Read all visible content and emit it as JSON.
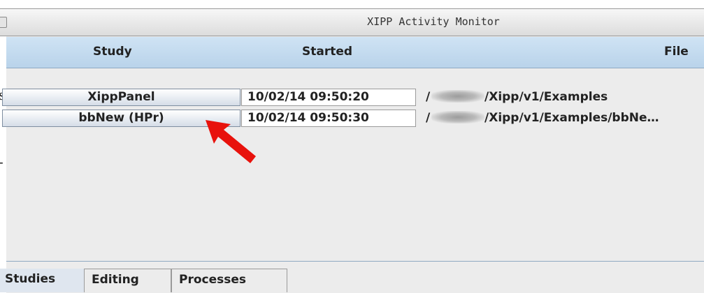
{
  "window": {
    "title": "XIPP Activity Monitor"
  },
  "left_strip": {
    "glyphs": [
      "s",
      "-"
    ]
  },
  "table": {
    "columns": [
      "Study",
      "Started",
      "File"
    ],
    "rows": [
      {
        "study": "XippPanel",
        "started": "10/02/14 09:50:20",
        "file_prefix": "/",
        "file_suffix": "/Xipp/v1/Examples"
      },
      {
        "study": "bbNew (HPr)",
        "started": "10/02/14 09:50:30",
        "file_prefix": "/",
        "file_suffix": "/Xipp/v1/Examples/bbNe…"
      }
    ]
  },
  "tabs": [
    "Studies",
    "Editing",
    "Processes"
  ],
  "colors": {
    "arrow": "#e8120c",
    "header": "#c6dcf0"
  },
  "icons": {
    "annotation": "red-arrow-icon"
  }
}
